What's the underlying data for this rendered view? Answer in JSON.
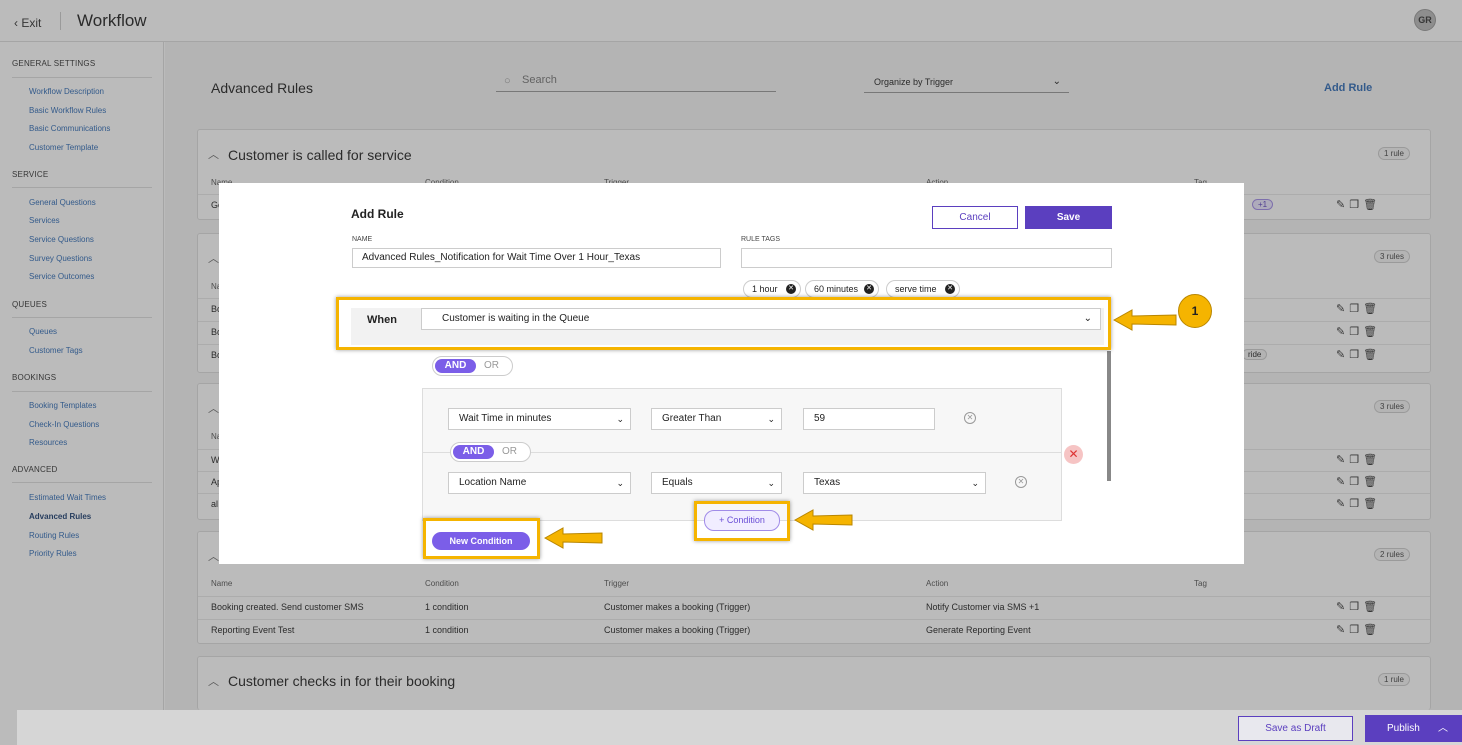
{
  "topbar": {
    "exit_label": "Exit",
    "title": "Workflow",
    "avatar_initials": "GR"
  },
  "sidebar": {
    "sections": [
      {
        "label": "GENERAL SETTINGS",
        "items": [
          "Workflow Description",
          "Basic Workflow Rules",
          "Basic Communications",
          "Customer Template"
        ]
      },
      {
        "label": "SERVICE",
        "items": [
          "General Questions",
          "Services",
          "Service Questions",
          "Survey Questions",
          "Service Outcomes"
        ]
      },
      {
        "label": "QUEUES",
        "items": [
          "Queues",
          "Customer Tags"
        ]
      },
      {
        "label": "BOOKINGS",
        "items": [
          "Booking Templates",
          "Check-In Questions",
          "Resources"
        ]
      },
      {
        "label": "ADVANCED",
        "items": [
          "Estimated Wait Times",
          "Advanced Rules",
          "Routing Rules",
          "Priority Rules"
        ]
      }
    ],
    "active_item": "Advanced Rules"
  },
  "main": {
    "title": "Advanced Rules",
    "search_placeholder": "Search",
    "organize_label": "Organize by Trigger",
    "add_rule_label": "Add Rule",
    "columns": [
      "Name",
      "Condition",
      "Trigger",
      "Action",
      "Tag"
    ],
    "cards": [
      {
        "title": "Customer is called for service",
        "badge": "1 rule",
        "peek_rows": [
          "Ge"
        ],
        "extra_badge": "+1"
      },
      {
        "title": "",
        "badge": "3 rules",
        "peek_rows": [
          "Bo",
          "Bo",
          "Bo"
        ],
        "extra_tag": "ride"
      },
      {
        "title": "",
        "badge": "3 rules",
        "peek_rows": [
          "W",
          "Ap",
          "al"
        ]
      },
      {
        "title": "",
        "badge": "2 rules",
        "rows": [
          {
            "name": "Booking created. Send customer SMS",
            "condition": "1 condition",
            "trigger": "Customer makes a booking (Trigger)",
            "action": "Notify Customer via SMS +1"
          },
          {
            "name": "Reporting Event Test",
            "condition": "1 condition",
            "trigger": "Customer makes a booking (Trigger)",
            "action": "Generate Reporting Event"
          }
        ]
      },
      {
        "title": "Customer checks in for their booking",
        "badge": "1 rule"
      }
    ]
  },
  "footer": {
    "save_draft_label": "Save as Draft",
    "publish_label": "Publish"
  },
  "modal": {
    "title": "Add Rule",
    "cancel_label": "Cancel",
    "save_label": "Save",
    "name_label": "NAME",
    "name_value": "Advanced Rules_Notification for Wait Time Over 1 Hour_Texas",
    "tags_label": "RULE TAGS",
    "tags": [
      "1 hour",
      "60 minutes",
      "serve time"
    ],
    "when_label": "When",
    "when_value": "Customer is waiting in the Queue",
    "and_label": "AND",
    "or_label": "OR",
    "conditions": [
      {
        "field": "Wait Time in minutes",
        "operator": "Greater Than",
        "value": "59"
      },
      {
        "field": "Location Name",
        "operator": "Equals",
        "value": "Texas"
      }
    ],
    "add_condition_label": "+ Condition",
    "new_condition_label": "New Condition"
  },
  "callout": {
    "number": "1",
    "highlight_color": "#f5b400"
  },
  "colors": {
    "accent": "#5b3fbf",
    "link": "#2f6bb5",
    "highlight": "#f5b400"
  }
}
